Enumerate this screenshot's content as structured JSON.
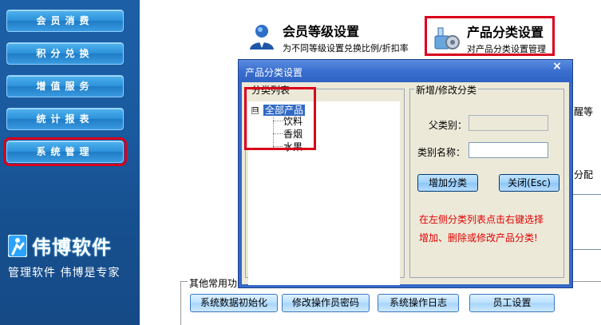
{
  "sidebar": {
    "items": [
      {
        "label": "会员消费"
      },
      {
        "label": "积分兑换"
      },
      {
        "label": "增值服务"
      },
      {
        "label": "统计报表"
      },
      {
        "label": "系统管理",
        "active": true
      }
    ],
    "brand_title": "伟博软件",
    "brand_sub": "管理软件 伟博是专家"
  },
  "features": {
    "member_level": {
      "title": "会员等级设置",
      "desc": "为不同等级设置兑换比例/折扣率"
    },
    "product_category": {
      "title": "产品分类设置",
      "desc": "对产品分类设置管理"
    }
  },
  "edge_fragments": {
    "right_top": "醒等",
    "right_mid": "分配",
    "left_group": "其他常用功"
  },
  "common": {
    "buttons": [
      "系统数据初始化",
      "修改操作员密码",
      "系统操作日志",
      "员工设置"
    ]
  },
  "dialog": {
    "title": "产品分类设置",
    "close_symbol": "×",
    "tree_group_label": "分类列表",
    "tree": {
      "toggle": "⊟",
      "root": "全部产品",
      "children": [
        "饮料",
        "香烟",
        "水果"
      ]
    },
    "form_group_label": "新增/修改分类",
    "parent_label": "父类别：",
    "name_label": "类别名称：",
    "parent_value": "",
    "name_value": "",
    "add_button": "增加分类",
    "close_button": "关闭(Esc)",
    "hint_line1": "在左侧分类列表点击右键选择",
    "hint_line2": "增加、删除或修改产品分类!"
  },
  "colors": {
    "highlight": "#d9001b",
    "sidebar_bg": "#1a5a9f",
    "dialog_blue": "#3569c8",
    "hint_red": "#e00000"
  }
}
